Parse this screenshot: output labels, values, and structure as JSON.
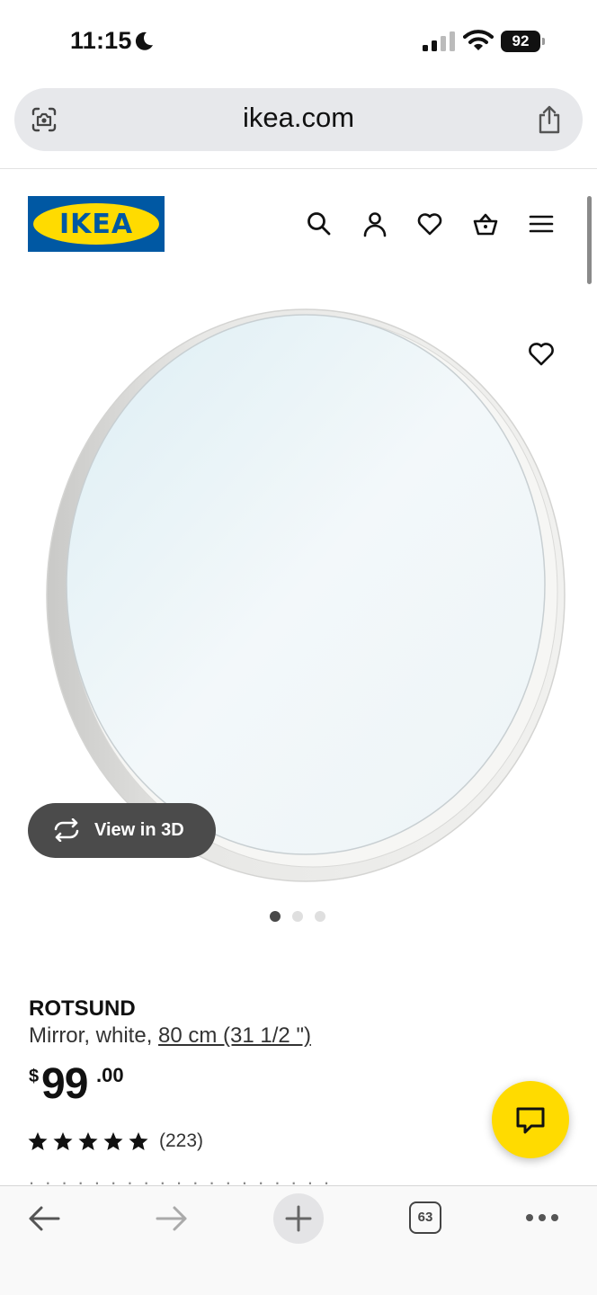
{
  "status_bar": {
    "time": "11:15",
    "battery": "92",
    "icons": [
      "moon-icon",
      "signal-icon",
      "wifi-icon",
      "battery-icon"
    ]
  },
  "browser": {
    "url": "ikea.com",
    "icons": [
      "page-settings-icon",
      "share-icon"
    ]
  },
  "header": {
    "logo_text": "IKEA",
    "nav_icons": [
      "search-icon",
      "account-icon",
      "favorites-icon",
      "cart-icon",
      "menu-icon"
    ],
    "colors": {
      "logo_blue": "#0058a3",
      "logo_yellow": "#ffdb00"
    }
  },
  "gallery": {
    "view_3d_label": "View in 3D",
    "slide_count": 3,
    "active_slide": 1
  },
  "product": {
    "name": "ROTSUND",
    "description": "Mirror, white, ",
    "size": "80 cm (31 1/2 \")",
    "price_currency": "$",
    "price_integer": "99",
    "price_decimal": ".00",
    "rating": 5,
    "review_count": "(223)"
  },
  "chat": {
    "icon": "chat-icon",
    "color": "#ffdb00"
  },
  "toolbar": {
    "tab_count": "63",
    "icons": [
      "back-icon",
      "forward-icon",
      "new-tab-icon",
      "tabs-icon",
      "more-icon"
    ]
  }
}
